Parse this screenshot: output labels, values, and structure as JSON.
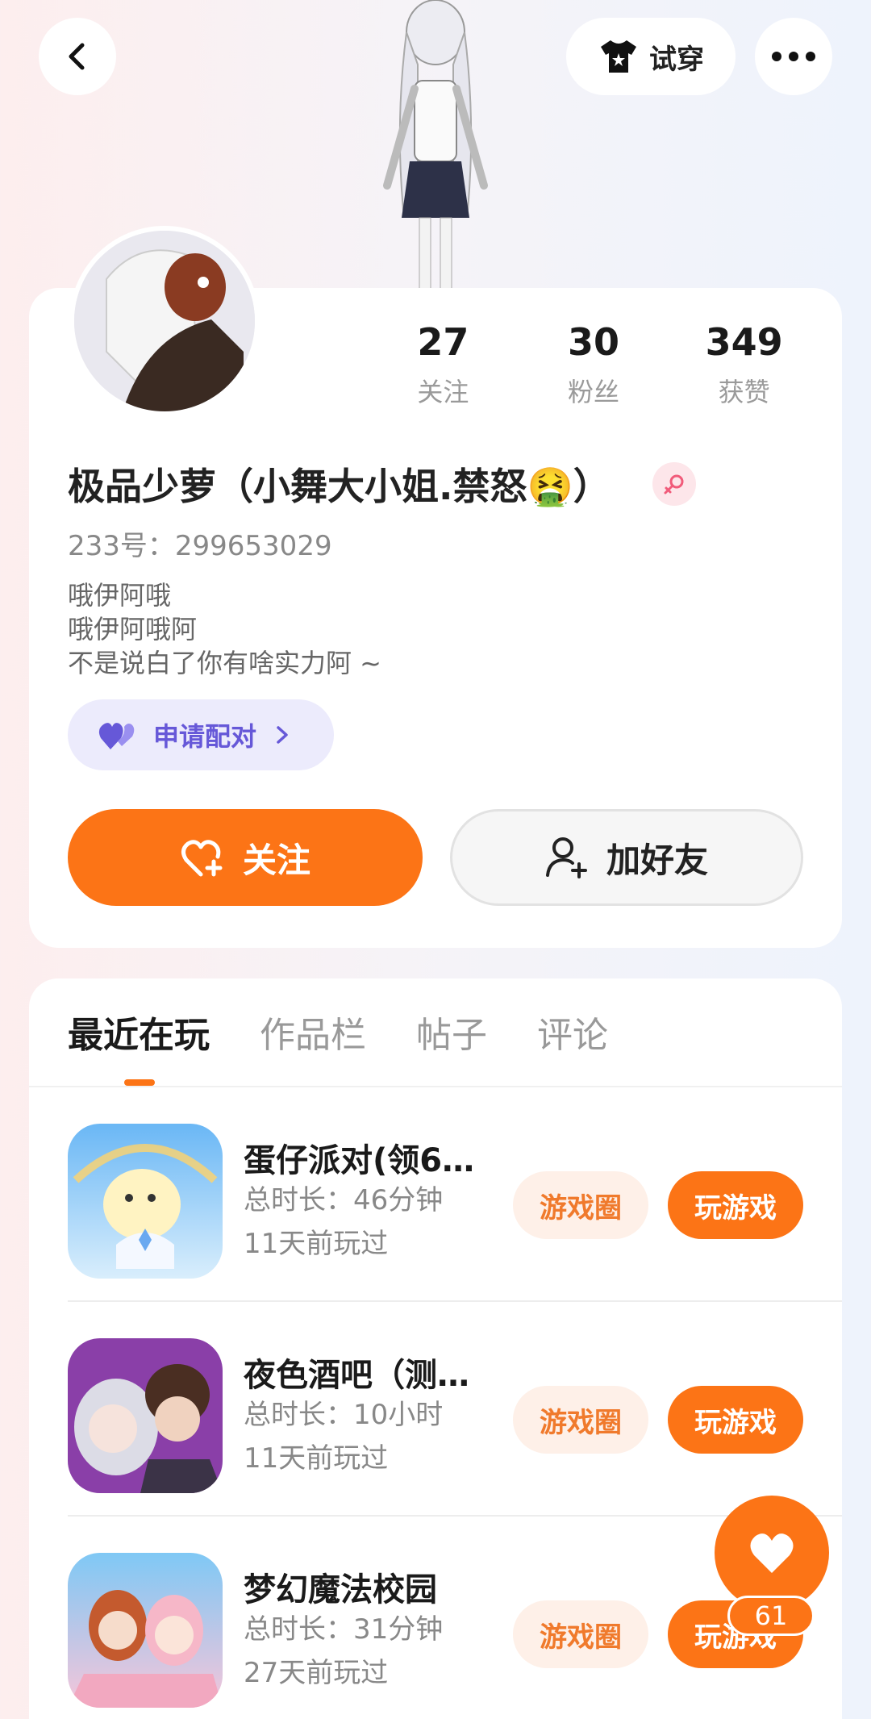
{
  "header": {
    "tryon_label": "试穿"
  },
  "stats": [
    {
      "value": "27",
      "label": "关注"
    },
    {
      "value": "30",
      "label": "粉丝"
    },
    {
      "value": "349",
      "label": "获赞"
    }
  ],
  "profile": {
    "nickname": "极品少萝（小舞大小姐.禁怒🤮）",
    "uid": "233号：299653029",
    "bio": [
      "哦伊阿哦",
      "哦伊阿哦阿",
      "不是说白了你有啥实力阿 ~"
    ],
    "match_label": "申请配对"
  },
  "actions": {
    "follow_label": "关注",
    "add_friend_label": "加好友"
  },
  "tabs": [
    "最近在玩",
    "作品栏",
    "帖子",
    "评论"
  ],
  "games": [
    {
      "name": "蛋仔派对(领6…",
      "duration": "总时长：46分钟",
      "last_played": "11天前玩过",
      "circle_label": "游戏圈",
      "play_label": "玩游戏"
    },
    {
      "name": "夜色酒吧（测…",
      "duration": "总时长：10小时",
      "last_played": "11天前玩过",
      "circle_label": "游戏圈",
      "play_label": "玩游戏"
    },
    {
      "name": "梦幻魔法校园",
      "duration": "总时长：31分钟",
      "last_played": "27天前玩过",
      "circle_label": "游戏圈",
      "play_label": "玩游戏"
    }
  ],
  "fab": {
    "count": "61"
  },
  "colors": {
    "accent": "#fc7416",
    "match": "#6658d8"
  }
}
